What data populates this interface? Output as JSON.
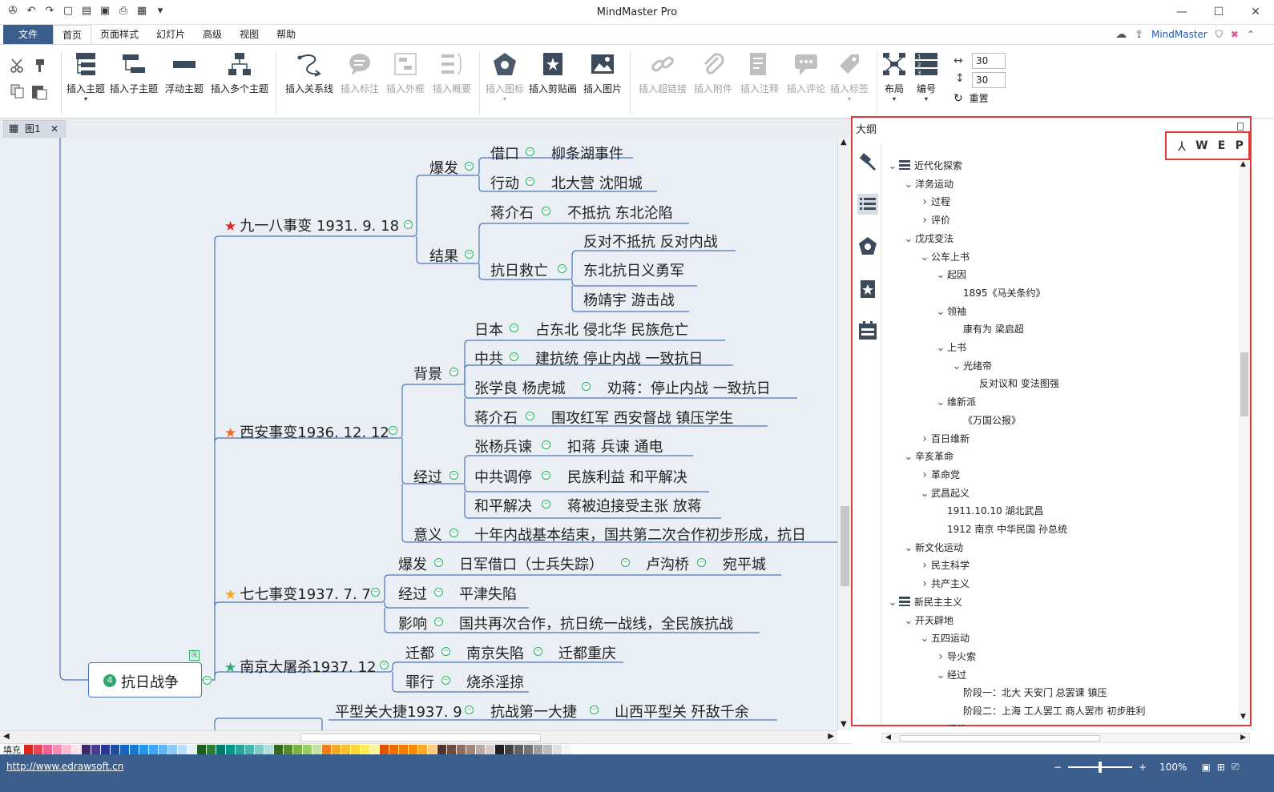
{
  "app": {
    "title": "MindMaster Pro"
  },
  "menu": {
    "file": "文件",
    "items": [
      "首页",
      "页面样式",
      "幻灯片",
      "高级",
      "视图",
      "帮助"
    ],
    "brand": "MindMaster"
  },
  "ribbon": {
    "insert_topic": "插入主题",
    "insert_subtopic": "插入子主题",
    "floating_topic": "浮动主题",
    "insert_multi": "插入多个主题",
    "insert_relation": "插入关系线",
    "insert_callout": "插入标注",
    "insert_boundary": "插入外框",
    "insert_summary": "插入概要",
    "insert_icon": "插入图标",
    "insert_clipart": "插入剪贴画",
    "insert_image": "插入图片",
    "insert_hyperlink": "插入超链接",
    "insert_attachment": "插入附件",
    "insert_note": "插入注释",
    "insert_comment": "插入评论",
    "insert_tag": "插入标签",
    "layout": "布局",
    "numbering": "编号",
    "spacing_h": "30",
    "spacing_v": "30",
    "reset": "重置"
  },
  "doc_tab": {
    "name": "图1"
  },
  "mindmap": {
    "root": {
      "badge": "4",
      "label": "抗日战争"
    },
    "n918": {
      "label": "九一八事变  1931. 9. 18",
      "star_color": "#d9261c"
    },
    "n918_outbreak": "爆发",
    "n918_pretext": "借口",
    "n918_pretext_val": "柳条湖事件",
    "n918_action": "行动",
    "n918_action_val": "北大营  沈阳城",
    "n918_result": "结果",
    "n918_jiang": "蒋介石",
    "n918_jiang_val": "不抵抗  东北沦陷",
    "n918_resist": "抗日救亡",
    "n918_r1": "反对不抵抗  反对内战",
    "n918_r2": "东北抗日义勇军",
    "n918_r3": "杨靖宇  游击战",
    "xian": {
      "label": "西安事变1936. 12. 12",
      "star_color": "#f26b21"
    },
    "xian_bg": "背景",
    "xian_bg1k": "日本",
    "xian_bg1v": "占东北    侵北华    民族危亡",
    "xian_bg2k": "中共",
    "xian_bg2v": "建抗统    停止内战  一致抗日",
    "xian_bg3k": "张学良  杨虎城",
    "xian_bg3v": "劝蒋：停止内战    一致抗日",
    "xian_bg4k": "蒋介石",
    "xian_bg4v": "围攻红军  西安督战    镇压学生",
    "xian_proc": "经过",
    "xian_p1k": "张杨兵谏",
    "xian_p1v": "扣蒋    兵谏    通电",
    "xian_p2k": "中共调停",
    "xian_p2v": "民族利益    和平解决",
    "xian_p3k": "和平解决",
    "xian_p3v": "蒋被迫接受主张  放蒋",
    "xian_sig": "意义",
    "xian_sig_val": "十年内战基本结束，国共第二次合作初步形成，抗日",
    "n77": {
      "label": "七七事变1937. 7. 7",
      "star_color": "#f5a623"
    },
    "n77_out": "爆发",
    "n77_out_v1": "日军借口（士兵失踪）",
    "n77_out_v2": "卢沟桥",
    "n77_out_v3": "宛平城",
    "n77_proc": "经过",
    "n77_proc_v": "平津失陷",
    "n77_eff": "影响",
    "n77_eff_v": "国共再次合作，抗日统一战线，全民族抗战",
    "nanjing": {
      "label": "南京大屠杀1937. 12",
      "star_color": "#2bab6b"
    },
    "nj_move": "迁都",
    "nj_move_v1": "南京失陷",
    "nj_move_v2": "迁都重庆",
    "nj_crime": "罪行",
    "nj_crime_v": "烧杀淫掠",
    "pxg": "平型关大捷1937. 9",
    "pxg_v1": "抗战第一大捷",
    "pxg_v2": "山西平型关    歼敌千余"
  },
  "outline": {
    "title": "大纲",
    "export": [
      "W",
      "E",
      "P"
    ],
    "rows": [
      {
        "text": "近代化探索",
        "level": 0,
        "arrow": "down",
        "stack": true
      },
      {
        "text": "洋务运动",
        "level": 1,
        "arrow": "down"
      },
      {
        "text": "过程",
        "level": 2,
        "arrow": "right"
      },
      {
        "text": "评价",
        "level": 2,
        "arrow": "right"
      },
      {
        "text": "戊戌变法",
        "level": 1,
        "arrow": "down"
      },
      {
        "text": "公车上书",
        "level": 2,
        "arrow": "down"
      },
      {
        "text": "起因",
        "level": 3,
        "arrow": "down"
      },
      {
        "text": "1895《马关条约》",
        "level": 4,
        "arrow": ""
      },
      {
        "text": "领袖",
        "level": 3,
        "arrow": "down"
      },
      {
        "text": "康有为  梁启超",
        "level": 4,
        "arrow": ""
      },
      {
        "text": "上书",
        "level": 3,
        "arrow": "down"
      },
      {
        "text": "光绪帝",
        "level": 4,
        "arrow": "down"
      },
      {
        "text": "反对议和   变法图强",
        "level": 5,
        "arrow": ""
      },
      {
        "text": "维新派",
        "level": 3,
        "arrow": "down"
      },
      {
        "text": "《万国公报》",
        "level": 4,
        "arrow": ""
      },
      {
        "text": "百日维新",
        "level": 2,
        "arrow": "right"
      },
      {
        "text": "辛亥革命",
        "level": 1,
        "arrow": "down"
      },
      {
        "text": "革命党",
        "level": 2,
        "arrow": "right"
      },
      {
        "text": "武昌起义",
        "level": 2,
        "arrow": "down"
      },
      {
        "text": "1911.10.10 湖北武昌",
        "level": 3,
        "arrow": ""
      },
      {
        "text": "1912 南京 中华民国 孙总统",
        "level": 3,
        "arrow": ""
      },
      {
        "text": "新文化运动",
        "level": 1,
        "arrow": "down"
      },
      {
        "text": "民主科学",
        "level": 2,
        "arrow": "right"
      },
      {
        "text": "共产主义",
        "level": 2,
        "arrow": "right"
      },
      {
        "text": "新民主主义",
        "level": 0,
        "arrow": "down",
        "stack": true
      },
      {
        "text": "开天辟地",
        "level": 1,
        "arrow": "down"
      },
      {
        "text": "五四运动",
        "level": 2,
        "arrow": "down"
      },
      {
        "text": "导火索",
        "level": 3,
        "arrow": "right"
      },
      {
        "text": "经过",
        "level": 3,
        "arrow": "down"
      },
      {
        "text": "阶段一：北大 天安门 总罢课  镇压",
        "level": 4,
        "arrow": ""
      },
      {
        "text": "阶段二：上海 工人罢工  商人罢市  初步胜利",
        "level": 4,
        "arrow": ""
      },
      {
        "text": "评价",
        "level": 3,
        "arrow": "right"
      }
    ]
  },
  "palette": {
    "label": "填充"
  },
  "status": {
    "url": "http://www.edrawsoft.cn",
    "zoom": "100%"
  },
  "colors": {
    "accent": "#3b5e8c",
    "highlight": "#e03a3a",
    "line": "#4a76b8"
  }
}
